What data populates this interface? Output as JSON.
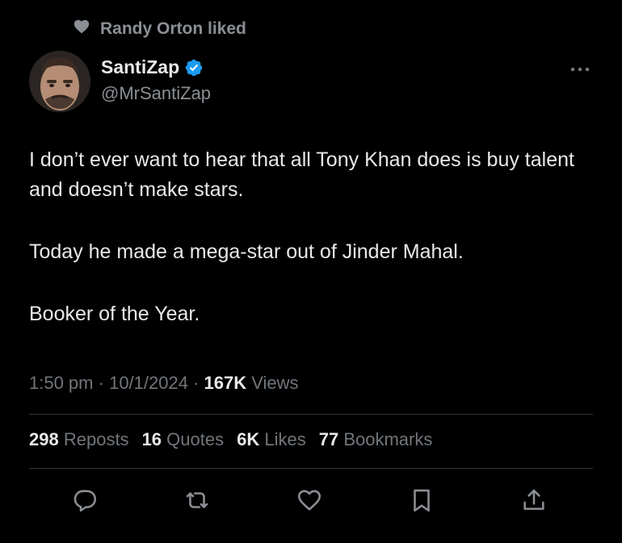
{
  "social_context": {
    "text": "Randy Orton liked",
    "icon": "heart-icon"
  },
  "author": {
    "display_name": "SantiZap",
    "handle": "@MrSantiZap",
    "verified": true,
    "verified_color": "#1d9bf0"
  },
  "tweet": {
    "paragraphs": [
      "I don’t ever want to hear that all Tony Khan does is buy talent and doesn’t make stars.",
      "Today he made a mega-star out of Jinder Mahal.",
      "Booker of the Year."
    ]
  },
  "meta": {
    "time": "1:50 pm",
    "separator": "·",
    "date": "10/1/2024",
    "views_count": "167K",
    "views_label": "Views"
  },
  "stats": [
    {
      "count": "298",
      "label": "Reposts"
    },
    {
      "count": "16",
      "label": "Quotes"
    },
    {
      "count": "6K",
      "label": "Likes"
    },
    {
      "count": "77",
      "label": "Bookmarks"
    }
  ],
  "actions": [
    {
      "icon": "reply-icon"
    },
    {
      "icon": "repost-icon"
    },
    {
      "icon": "like-icon"
    },
    {
      "icon": "bookmark-icon"
    },
    {
      "icon": "share-icon"
    }
  ],
  "colors": {
    "background": "#000000",
    "text_primary": "#e7e9ea",
    "text_secondary": "#71767b",
    "divider": "#2f3336",
    "icon": "#8b8f94"
  }
}
